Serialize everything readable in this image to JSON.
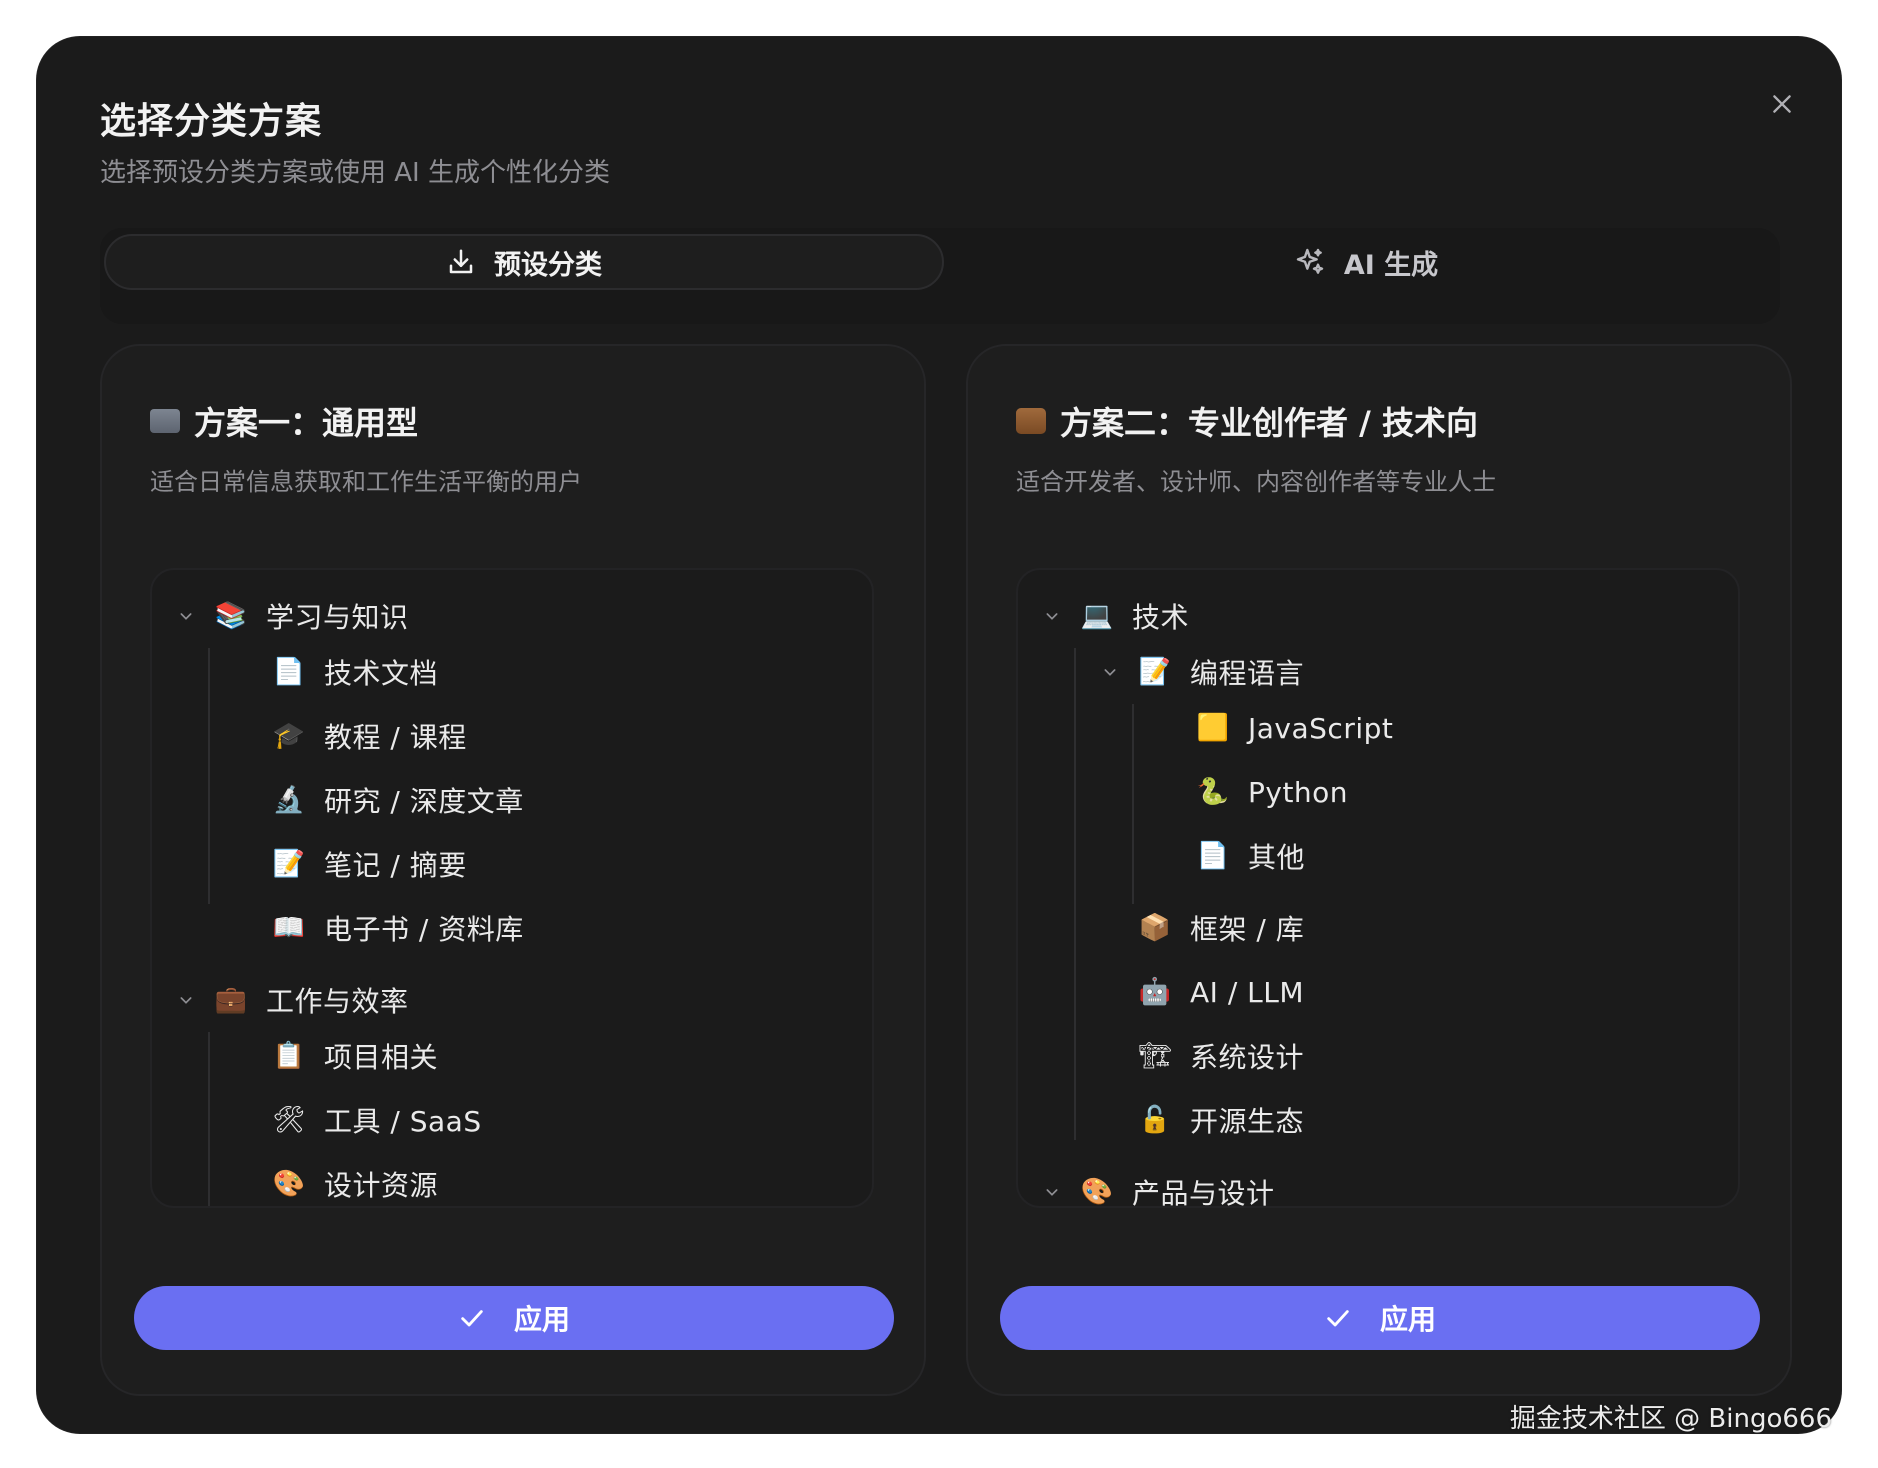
{
  "dialog": {
    "title": "选择分类方案",
    "subtitle": "选择预设分类方案或使用 AI 生成个性化分类"
  },
  "tabs": {
    "preset_label": "预设分类",
    "ai_label": "AI 生成"
  },
  "plans": [
    {
      "title": "方案一：通用型",
      "icon": "folder-icon",
      "description": "适合日常信息获取和工作生活平衡的用户",
      "apply_label": "应用",
      "tree": [
        {
          "label": "学习与知识",
          "icon": "books-icon",
          "glyph": "📚"
        },
        {
          "label": "技术文档",
          "icon": "document-icon",
          "glyph": "📄"
        },
        {
          "label": "教程 / 课程",
          "icon": "graduation-cap-icon",
          "glyph": "🎓"
        },
        {
          "label": "研究 / 深度文章",
          "icon": "microscope-icon",
          "glyph": "🔬"
        },
        {
          "label": "笔记 / 摘要",
          "icon": "memo-icon",
          "glyph": "📝"
        },
        {
          "label": "电子书 / 资料库",
          "icon": "open-book-icon",
          "glyph": "📖"
        },
        {
          "label": "工作与效率",
          "icon": "briefcase-icon",
          "glyph": "💼"
        },
        {
          "label": "项目相关",
          "icon": "clipboard-icon",
          "glyph": "📋"
        },
        {
          "label": "工具 / SaaS",
          "icon": "tools-icon",
          "glyph": "🛠"
        },
        {
          "label": "设计资源",
          "icon": "palette-icon",
          "glyph": "🎨"
        }
      ]
    },
    {
      "title": "方案二：专业创作者 / 技术向",
      "icon": "briefcase-icon",
      "description": "适合开发者、设计师、内容创作者等专业人士",
      "apply_label": "应用",
      "tree": [
        {
          "label": "技术",
          "icon": "laptop-icon",
          "glyph": "💻"
        },
        {
          "label": "编程语言",
          "icon": "memo-icon",
          "glyph": "📝"
        },
        {
          "label": "JavaScript",
          "icon": "yellow-square-icon",
          "glyph": "🟨"
        },
        {
          "label": "Python",
          "icon": "snake-icon",
          "glyph": "🐍"
        },
        {
          "label": "其他",
          "icon": "document-icon",
          "glyph": "📄"
        },
        {
          "label": "框架 / 库",
          "icon": "package-icon",
          "glyph": "📦"
        },
        {
          "label": "AI / LLM",
          "icon": "robot-icon",
          "glyph": "🤖"
        },
        {
          "label": "系统设计",
          "icon": "construction-crane-icon",
          "glyph": "🏗"
        },
        {
          "label": "开源生态",
          "icon": "lock-icon",
          "glyph": "🔓"
        },
        {
          "label": "产品与设计",
          "icon": "palette-icon",
          "glyph": "🎨"
        }
      ]
    }
  ],
  "watermark": "掘金技术社区 @ Bingo666"
}
